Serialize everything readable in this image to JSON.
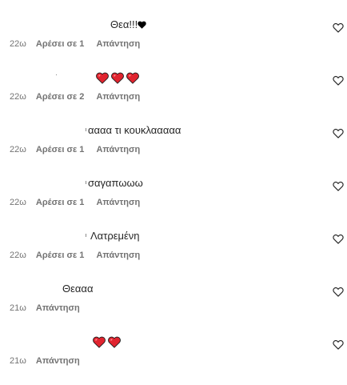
{
  "comments": [
    {
      "text": "Θεα!!!",
      "time": "22ω",
      "likes": "Αρέσει σε 1",
      "reply": "Απάντηση",
      "emoji": "black-heart-emoji"
    },
    {
      "text": "",
      "time": "22ω",
      "likes": "Αρέσει σε 2",
      "reply": "Απάντηση",
      "emoji": "red-heart-emoji x3"
    },
    {
      "text": "αααα τι κουκλααααα",
      "time": "22ω",
      "likes": "Αρέσει σε 1",
      "reply": "Απάντηση"
    },
    {
      "text": "σαγαπωωω",
      "time": "22ω",
      "likes": "Αρέσει σε 1",
      "reply": "Απάντηση"
    },
    {
      "text": "Λατρεμένη",
      "time": "22ω",
      "likes": "Αρέσει σε 1",
      "reply": "Απάντηση"
    },
    {
      "text": "Θεααα",
      "time": "21ω",
      "reply": "Απάντηση"
    },
    {
      "text": "",
      "time": "21ω",
      "reply": "Απάντηση",
      "emoji": "red-heart-emoji x2"
    }
  ],
  "colors": {
    "text": "#262626",
    "meta": "#737373",
    "heart_red": "#e0242f"
  },
  "icons": {
    "like": "heart-outline-icon"
  }
}
